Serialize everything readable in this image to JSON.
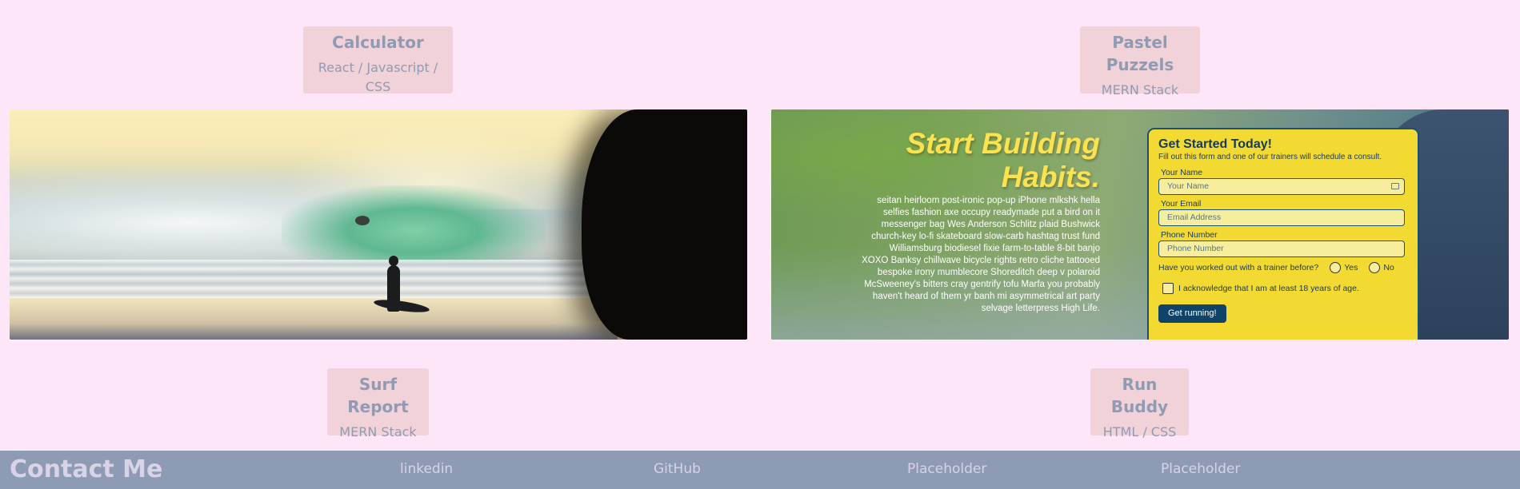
{
  "projects": [
    {
      "title": "Calculator",
      "stack": "React / Javascript / CSS"
    },
    {
      "title": "Pastel Puzzels",
      "stack": "MERN Stack"
    },
    {
      "title": "Surf Report",
      "stack": "MERN Stack"
    },
    {
      "title": "Run Buddy",
      "stack": "HTML / CSS"
    }
  ],
  "run_buddy_preview": {
    "title_line1": "Start Building",
    "title_line2": "Habits.",
    "body": "seitan heirloom post-ironic pop-up iPhone mlkshk hella selfies fashion axe occupy readymade put a bird on it messenger bag Wes Anderson Schlitz plaid Bushwick church-key lo-fi skateboard slow-carb hashtag trust fund Williamsburg biodiesel fixie farm-to-table 8-bit banjo XOXO Banksy chillwave bicycle rights retro cliche tattooed bespoke irony mumblecore Shoreditch deep v polaroid McSweeney's bitters cray gentrify tofu Marfa you probably haven't heard of them yr banh mi asymmetrical art party selvage letterpress High Life.",
    "form": {
      "heading": "Get Started Today!",
      "subheading": "Fill out this form and one of our trainers will schedule a consult.",
      "name_label": "Your Name",
      "name_placeholder": "Your Name",
      "email_label": "Your Email",
      "email_placeholder": "Email Address",
      "phone_label": "Phone Number",
      "phone_placeholder": "Phone Number",
      "question": "Have you worked out with a trainer before?",
      "yes": "Yes",
      "no": "No",
      "acknowledge": "I acknowledge that I am at least 18 years of age.",
      "submit": "Get running!"
    },
    "colors": {
      "accent": "#fde24f",
      "form_bg": "#f2da32",
      "button": "#0f4468"
    }
  },
  "footer": {
    "heading": "Contact Me",
    "links": [
      "linkedin",
      "GitHub",
      "Placeholder",
      "Placeholder"
    ]
  },
  "colors": {
    "page_bg": "#fee6f9",
    "label_bg": "#f2d2d9",
    "footer_bg": "#8e9bb4",
    "muted_text": "#8e9bb4"
  }
}
